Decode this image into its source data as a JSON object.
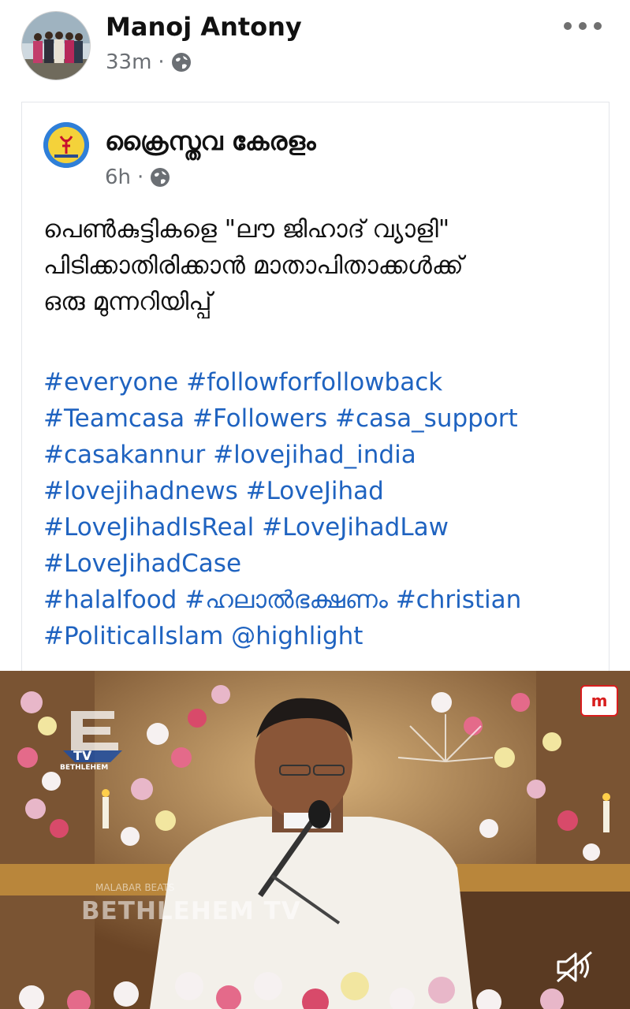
{
  "post": {
    "author": "Manoj Antony",
    "time": "33m",
    "separator": "·",
    "privacy_icon": "globe-icon",
    "menu_icon": "more-options-icon"
  },
  "shared": {
    "page_name": "ക്രൈസ്തവ കേരളം",
    "time": "6h",
    "separator": "·",
    "privacy_icon": "globe-icon",
    "text_lines": [
      "പെൺകുട്ടികളെ \"ലൗ ജിഹാദ് വ്യാളി\"",
      "പിടിക്കാതിരിക്കാൻ മാതാപിതാക്കൾക്ക്",
      "ഒരു മുന്നറിയിപ്പ്"
    ],
    "hashtag_lines": [
      [
        "#everyone",
        "#followforfollowback"
      ],
      [
        "#Teamcasa",
        " #Followers",
        "#casa_support"
      ],
      [
        "#casakannur",
        "#lovejihad_india"
      ],
      [
        "#lovejihadnews",
        "#LoveJihad"
      ],
      [
        "#LoveJihadIsReal",
        "#LoveJihadLaw"
      ],
      [
        "#LoveJihadCase"
      ],
      [
        "#halalfood",
        "#ഹലാൽഭക്ഷണം",
        "#christian"
      ],
      [
        "#PoliticalIslam",
        "@highlight"
      ]
    ]
  },
  "video": {
    "watermark": "BETHLEHEM TV",
    "watermark_small": "MALABAR BEATS",
    "channel_logo_text": "TV",
    "channel_logo_sub": "BETHLEHEM",
    "brand_badge": "m",
    "volume_icon": "volume-muted-icon"
  },
  "colors": {
    "hashtag": "#1f63c0",
    "meta_text": "#6b6f74"
  }
}
